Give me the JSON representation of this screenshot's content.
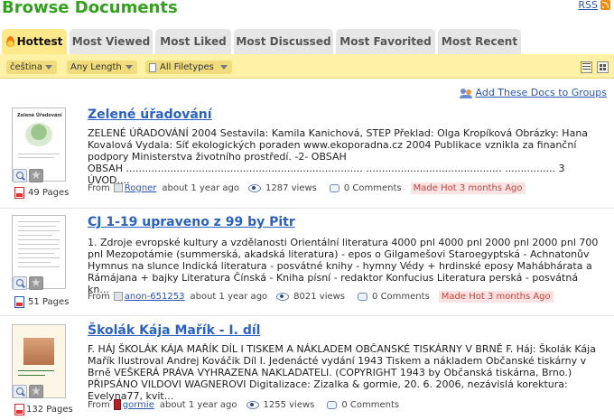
{
  "header": {
    "title": "Browse Documents",
    "rss_label": "RSS"
  },
  "tabs": [
    {
      "label": "Hottest",
      "active": true
    },
    {
      "label": "Most Viewed",
      "active": false
    },
    {
      "label": "Most Liked",
      "active": false
    },
    {
      "label": "Most Discussed",
      "active": false
    },
    {
      "label": "Most Favorited",
      "active": false
    },
    {
      "label": "Most Recent",
      "active": false
    }
  ],
  "filters": {
    "language": "čeština",
    "length": "Any Length",
    "filetype": "All Filetypes"
  },
  "add_to_groups": "Add These Docs to Groups",
  "documents": [
    {
      "title": "Zelené úřadování",
      "description": "ZELENÉ ÚŘADOVÁNÍ 2004 Sestavila: Kamila Kanichová, STEP Překlad: Olga Kropíková Obrázky: Hana Kovalová Vydala: Síť ekologických poraden www.ekoporadna.cz 2004 Publikace vznikla za finanční podpory Ministerstva životního prostředí. -2- OBSAH",
      "description_line2": "OBSAH ........................................................................... ........................................... ................ 3 ÚVOD....",
      "pages": "49 Pages",
      "from": "From",
      "user": "Rogner",
      "time": "about 1 year ago",
      "views": "1287 views",
      "comments": "0 Comments",
      "badge": "Made Hot 3 months Ago",
      "thumb_caption": "Zelené Úřadování"
    },
    {
      "title": "CJ 1-19 upraveno z 99 by Pitr",
      "description": "1. Zdroje evropské kultury a vzdělanosti Orientální literatura 4000 pnl 4000 pnl 2000 pnl 2000 pnl 700 pnl Mezopotámie (summerská, akadská literatura) - epos o Gilgamešovi Staroegyptská - Achnatonův Hymnus na slunce Indická literatura - posvátné knihy - hymny Védy + hrdinské eposy Mahábhárata a Rámájana + bajky Literatura Čínská - Kniha písní - redaktor Konfucius Literatura perská - posvátná kn...",
      "pages": "51 Pages",
      "from": "From",
      "user": "anon-651253",
      "time": "about 1 year ago",
      "views": "8021 views",
      "comments": "0 Comments",
      "badge": "Made Hot 3 months Ago"
    },
    {
      "title": "Školák Kája Mařík - I. díl",
      "description": "F. HÁJ ŠKOLÁK KÁJA MAŘÍK DÍL I TISKEM A NÁKLADEM OBČANSKÉ TISKÁRNY V BRNĚ F. Háj: Školák Kája Mařík Ilustroval Andrej Kováčik Díl I. Jedenácté vydání 1943 Tiskem a nákladem Občanské tiskárny v Brně VEŠKERÁ PRÁVA VYHRAZENA NAKLADATELI. (COPYRIGHT 1943 by Občanská tiskárna, Brno.) PŘIPSÁNO VILDOVI WAGNEROVI Digitalizace: Zizalka & gormie, 20. 6. 2006, nezávislá korektura: Evelyna77, kvit...",
      "pages": "132 Pages",
      "from": "From",
      "user": "gormie",
      "time": "about 1 year ago",
      "views": "1255 views",
      "comments": "0 Comments"
    }
  ]
}
